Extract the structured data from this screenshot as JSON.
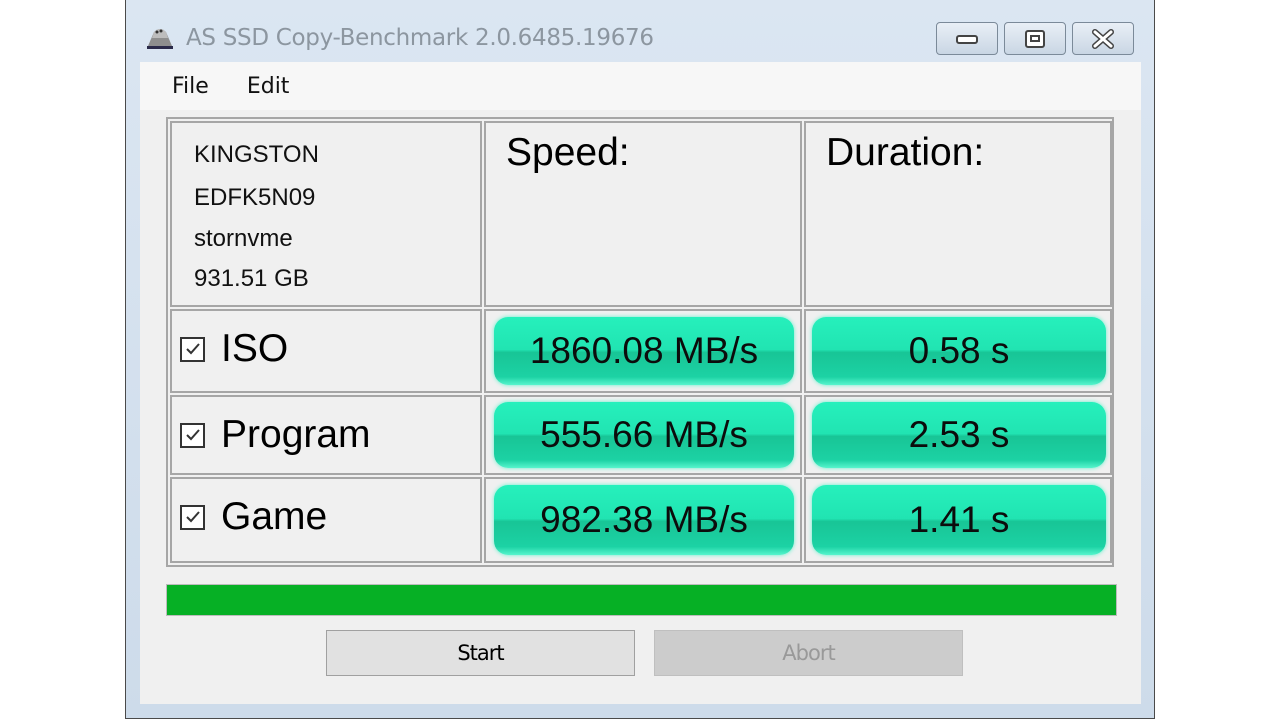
{
  "window": {
    "title": "AS SSD Copy-Benchmark 2.0.6485.19676",
    "app_icon": "drive-icon",
    "controls": {
      "minimize": "minimize-icon",
      "maximize": "maximize-icon",
      "close": "close-icon"
    }
  },
  "menu": {
    "items": [
      {
        "label": "File"
      },
      {
        "label": "Edit"
      }
    ]
  },
  "drive": {
    "vendor": "KINGSTON",
    "model": "EDFK5N09",
    "driver": "stornvme",
    "capacity": "931.51 GB"
  },
  "headers": {
    "speed": "Speed:",
    "duration": "Duration:"
  },
  "tests": [
    {
      "label": "ISO",
      "checked": true,
      "speed": "1860.08 MB/s",
      "duration": "0.58 s"
    },
    {
      "label": "Program",
      "checked": true,
      "speed": "555.66 MB/s",
      "duration": "2.53 s"
    },
    {
      "label": "Game",
      "checked": true,
      "speed": "982.38 MB/s",
      "duration": "1.41 s"
    }
  ],
  "progress": {
    "percent": 100,
    "color": "#06b025"
  },
  "buttons": {
    "start": "Start",
    "abort": "Abort",
    "abort_enabled": false
  },
  "colors": {
    "result_fill": "#21e4b2",
    "result_dark": "#18c596"
  }
}
